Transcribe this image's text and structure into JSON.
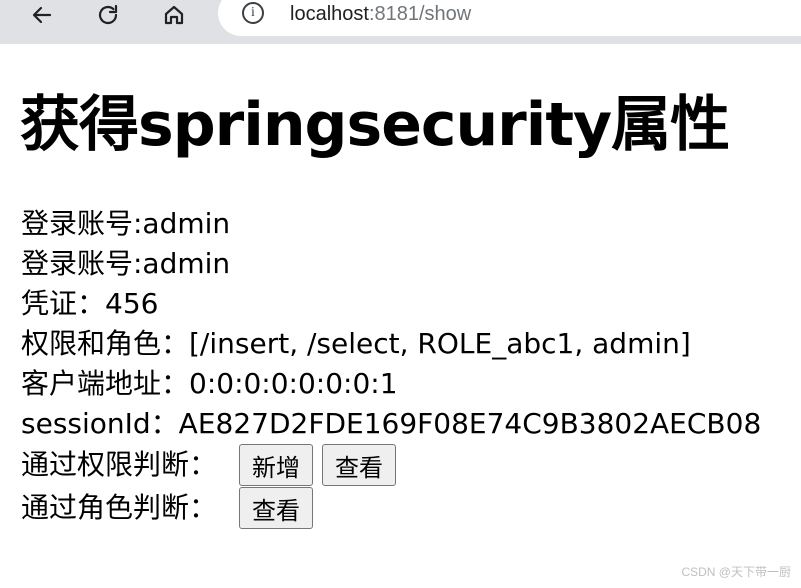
{
  "browser": {
    "url_host": "localhost",
    "url_rest": ":8181/show",
    "icons": [
      "back-icon",
      "reload-icon",
      "home-icon",
      "info-icon"
    ]
  },
  "page": {
    "title": "获得springsecurity属性",
    "lines": [
      "登录账号:admin",
      "登录账号:admin",
      "凭证：456",
      "权限和角色：[/insert, /select, ROLE_abc1, admin]",
      "客户端地址：0:0:0:0:0:0:0:1",
      "sessionId：AE827D2FDE169F08E74C9B3802AECB08"
    ],
    "permission_row": {
      "label": "通过权限判断：",
      "buttons": [
        "新增",
        "查看"
      ]
    },
    "role_row": {
      "label": "通过角色判断：",
      "buttons": [
        "查看"
      ]
    }
  },
  "watermark": "CSDN @天下带一厨"
}
